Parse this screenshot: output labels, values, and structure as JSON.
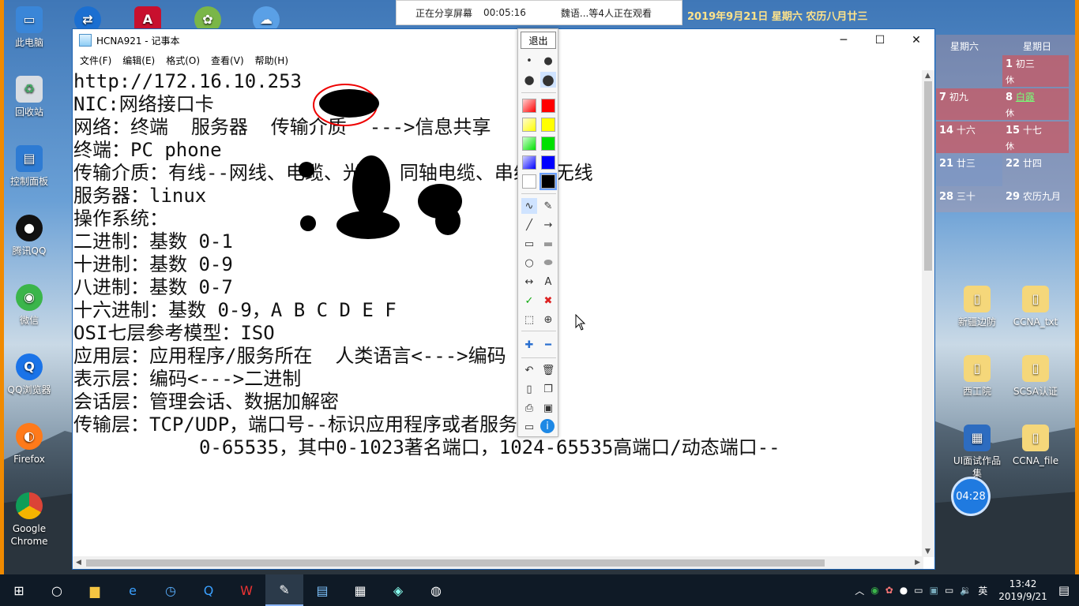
{
  "share": {
    "sharing": "正在分享屏幕",
    "elapsed": "00:05:16",
    "viewers": "魏语...等4人正在观看"
  },
  "desktop_icons_left": [
    "此电脑",
    "回收站",
    "控制面板",
    "腾讯QQ",
    "微信",
    "QQ浏览器",
    "Firefox",
    "Google Chrome"
  ],
  "desktop_icons_right": [
    "新疆边防",
    "CCNA_txt",
    "西工院",
    "SCSA认证",
    "UI面试作品集",
    "CCNA_file"
  ],
  "calendar": {
    "header": "2019年9月21日 星期六 农历八月廿三",
    "col1": "星期六",
    "col2": "星期日",
    "cells": [
      {
        "day": "1",
        "lunar": "初三",
        "rest": "休"
      },
      {
        "day": "7",
        "lunar": "初九",
        "rest": ""
      },
      {
        "day": "8",
        "lunar": "白露",
        "rest": "休"
      },
      {
        "day": "14",
        "lunar": "十六",
        "rest": ""
      },
      {
        "day": "15",
        "lunar": "十七",
        "rest": "休"
      },
      {
        "day": "21",
        "lunar": "廿三",
        "rest": ""
      },
      {
        "day": "22",
        "lunar": "廿四",
        "rest": ""
      },
      {
        "day": "28",
        "lunar": "三十",
        "rest": ""
      },
      {
        "day": "29",
        "lunar": "农历九月",
        "rest": ""
      }
    ]
  },
  "timer": "04:28",
  "notepad": {
    "title": "HCNA921 - 记事本",
    "menu": [
      "文件(F)",
      "编辑(E)",
      "格式(O)",
      "查看(V)",
      "帮助(H)"
    ],
    "lines": [
      "http://172.16.10.253",
      "NIC:网络接口卡",
      "网络：终端  服务器  传输介质  --->信息共享",
      "",
      "终端：PC phone",
      "传输介质：有线--网线、电缆、光纤、同轴电缆、串线  无线",
      "服务器：linux",
      "",
      "操作系统：",
      "",
      "",
      "二进制：基数 0-1",
      "十进制：基数 0-9",
      "八进制：基数 0-7",
      "十六进制：基数 0-9，A B C D E F",
      "OSI七层参考模型：ISO",
      "应用层：应用程序/服务所在  人类语言<--->编码",
      "表示层：编码<--->二进制",
      "会话层：管理会话、数据加解密",
      "传输层：TCP/UDP，端口号--标识应用程序或者服务",
      "           0-65535，其中0-1023著名端口，1024-65535高端口/动态端口--"
    ]
  },
  "annotation_toolbar": {
    "exit": "退出"
  },
  "colors": {
    "accent": "#1e64b4",
    "red": "#ff0000",
    "yellow": "#ffff00",
    "green": "#00e000",
    "blue": "#0000ff",
    "black": "#000000"
  },
  "taskbar": {
    "ime": "英",
    "time": "13:42",
    "date": "2019/9/21"
  }
}
